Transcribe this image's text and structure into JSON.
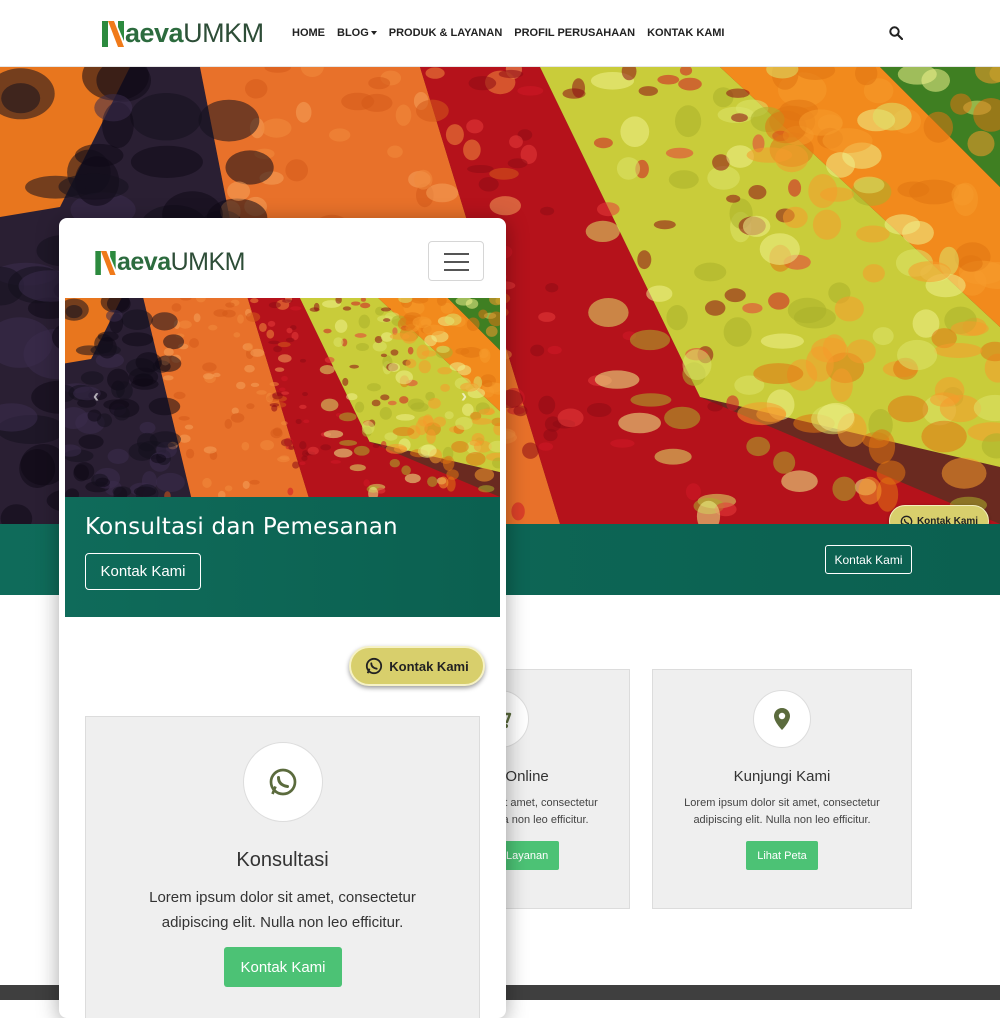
{
  "brand": {
    "first_letter": "N",
    "name_bold": "aeva",
    "name_rest": "UMKM"
  },
  "nav": {
    "items": [
      "HOME",
      "BLOG",
      "PRODUK & LAYANAN",
      "PROFIL PERUSAHAAN",
      "KONTAK KAMI"
    ],
    "search_icon": "search-icon"
  },
  "hero": {
    "band_button": "Kontak Kami"
  },
  "whatsapp": {
    "label": "Kontak Kami",
    "icon": "whatsapp-icon"
  },
  "cards": [
    {
      "icon": "cart-icon",
      "title": "Belanja Online",
      "text": "Lorem ipsum dolor sit amet, consectetur adipiscing elit. Nulla non leo efficitur.",
      "button": "Produk & Layanan"
    },
    {
      "icon": "map-marker-icon",
      "title": "Kunjungi Kami",
      "text": "Lorem ipsum dolor sit amet, consectetur adipiscing elit. Nulla non leo efficitur.",
      "button": "Lihat Peta"
    }
  ],
  "mobile": {
    "menu_icon": "hamburger-icon",
    "banner_title": "Konsultasi dan Pemesanan",
    "banner_button": "Kontak Kami",
    "card": {
      "icon": "whatsapp-icon",
      "title": "Konsultasi",
      "text": "Lorem ipsum dolor sit amet, consectetur adipiscing elit. Nulla non leo efficitur.",
      "button": "Kontak Kami"
    }
  },
  "colors": {
    "brand_green": "#2c6b3e",
    "brand_orange": "#f07a1a",
    "teal": "#0d6655",
    "button_green": "#4cc275",
    "whatsapp_pill": "#d8cf6c",
    "footer": "#3f3f3f"
  }
}
